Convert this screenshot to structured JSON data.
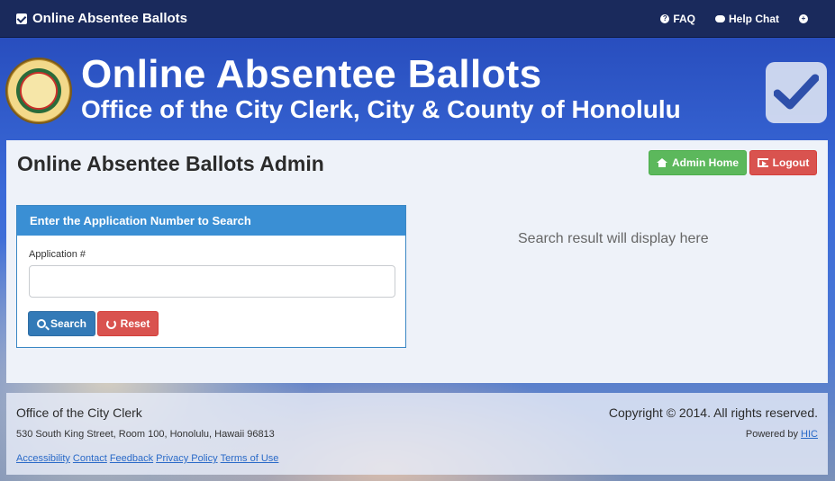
{
  "navbar": {
    "brand": "Online Absentee Ballots",
    "faq": "FAQ",
    "help_chat": "Help Chat"
  },
  "header": {
    "title": "Online Absentee Ballots",
    "subtitle": "Office of the City Clerk, City & County of Honolulu"
  },
  "panel": {
    "title": "Online Absentee Ballots Admin",
    "admin_home": "Admin Home",
    "logout": "Logout"
  },
  "search_card": {
    "heading": "Enter the Application Number to Search",
    "field_label": "Application #",
    "field_value": "",
    "search_label": "Search",
    "reset_label": "Reset"
  },
  "result": {
    "placeholder": "Search result will display here"
  },
  "footer": {
    "org": "Office of the City Clerk",
    "address": "530 South King Street, Room 100, Honolulu, Hawaii 96813",
    "links": [
      "Accessibility",
      "Contact",
      "Feedback",
      "Privacy Policy",
      "Terms of Use"
    ],
    "copyright": "Copyright © 2014. All rights reserved.",
    "powered_prefix": "Powered by",
    "powered_link": "HIC"
  },
  "colors": {
    "navbar": "#1a2a5c",
    "success": "#5cb85c",
    "danger": "#d9534f",
    "primary": "#337ab7",
    "card_header": "#3a8fd4"
  },
  "icons": [
    "check-square-icon",
    "question-circle-icon",
    "chat-icon",
    "plus-circle-icon",
    "home-icon",
    "logout-icon",
    "search-icon",
    "refresh-icon",
    "big-check-icon",
    "seal-logo"
  ]
}
